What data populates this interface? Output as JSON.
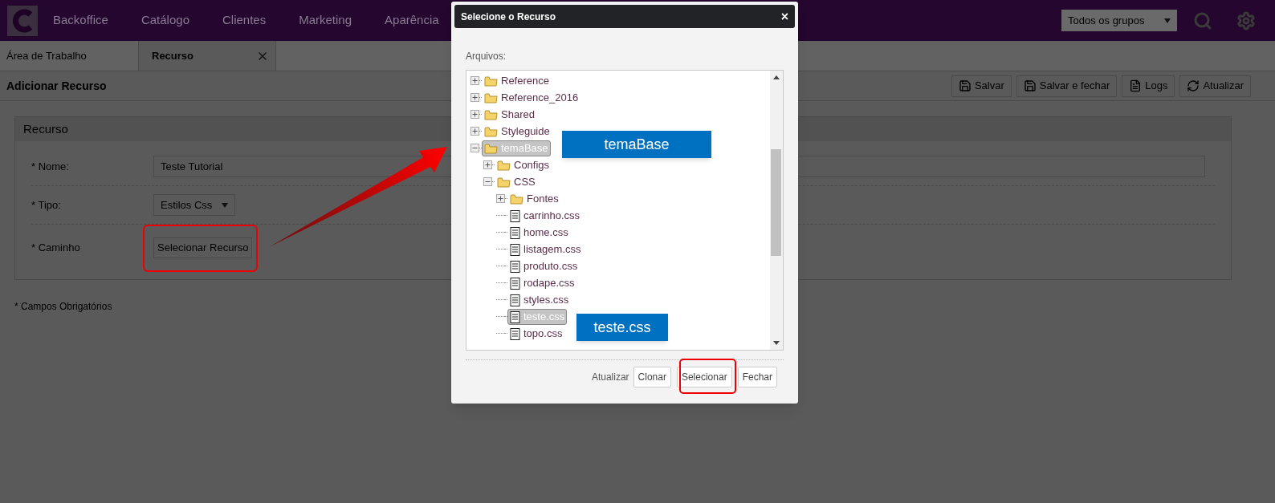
{
  "nav": {
    "items": [
      "Backoffice",
      "Catálogo",
      "Clientes",
      "Marketing",
      "Aparência"
    ],
    "group_select": "Todos os grupos"
  },
  "tabs": [
    {
      "label": "Área de Trabalho",
      "selected": false,
      "closable": false
    },
    {
      "label": "Recurso",
      "selected": true,
      "closable": true
    }
  ],
  "page": {
    "title": "Adicionar Recurso",
    "actions": [
      {
        "label": "Salvar",
        "kind": "save"
      },
      {
        "label": "Salvar e fechar",
        "kind": "save"
      },
      {
        "label": "Logs",
        "kind": "document"
      },
      {
        "label": "Atualizar",
        "kind": "refresh"
      }
    ]
  },
  "form": {
    "title": "Recurso",
    "fields": [
      {
        "label": "* Nome:",
        "kind": "text",
        "value": "Teste Tutorial"
      },
      {
        "label": "* Tipo:",
        "kind": "select",
        "value": "Estilos Css"
      },
      {
        "label": "* Caminho",
        "kind": "button",
        "value": "Selecionar Recurso"
      }
    ],
    "note": "* Campos Obrigatórios"
  },
  "dialog": {
    "title": "Selecione o Recurso",
    "close": "×",
    "files_label": "Arquivos:",
    "tree": [
      {
        "name": "Reference",
        "kind": "folder",
        "expanded": false,
        "selected": false
      },
      {
        "name": "Reference_2016",
        "kind": "folder",
        "expanded": false,
        "selected": false
      },
      {
        "name": "Shared",
        "kind": "folder",
        "expanded": false,
        "selected": false
      },
      {
        "name": "Styleguide",
        "kind": "folder",
        "expanded": false,
        "selected": false
      },
      {
        "name": "temaBase",
        "kind": "folder",
        "expanded": true,
        "selected": true,
        "children": [
          {
            "name": "Configs",
            "kind": "folder",
            "expanded": false,
            "selected": false
          },
          {
            "name": "CSS",
            "kind": "folder",
            "expanded": true,
            "selected": false,
            "children": [
              {
                "name": "Fontes",
                "kind": "folder",
                "expanded": false,
                "selected": false
              },
              {
                "name": "carrinho.css",
                "kind": "file",
                "selected": false
              },
              {
                "name": "home.css",
                "kind": "file",
                "selected": false
              },
              {
                "name": "listagem.css",
                "kind": "file",
                "selected": false
              },
              {
                "name": "produto.css",
                "kind": "file",
                "selected": false
              },
              {
                "name": "rodape.css",
                "kind": "file",
                "selected": false
              },
              {
                "name": "styles.css",
                "kind": "file",
                "selected": false
              },
              {
                "name": "teste.css",
                "kind": "file",
                "selected": true
              },
              {
                "name": "topo.css",
                "kind": "file",
                "selected": false
              }
            ]
          }
        ]
      }
    ],
    "footer": {
      "text": "Atualizar",
      "buttons": [
        "Clonar",
        "Selecionar",
        "Fechar"
      ]
    }
  },
  "annotations": [
    {
      "text": "temaBase"
    },
    {
      "text": "teste.css"
    }
  ]
}
